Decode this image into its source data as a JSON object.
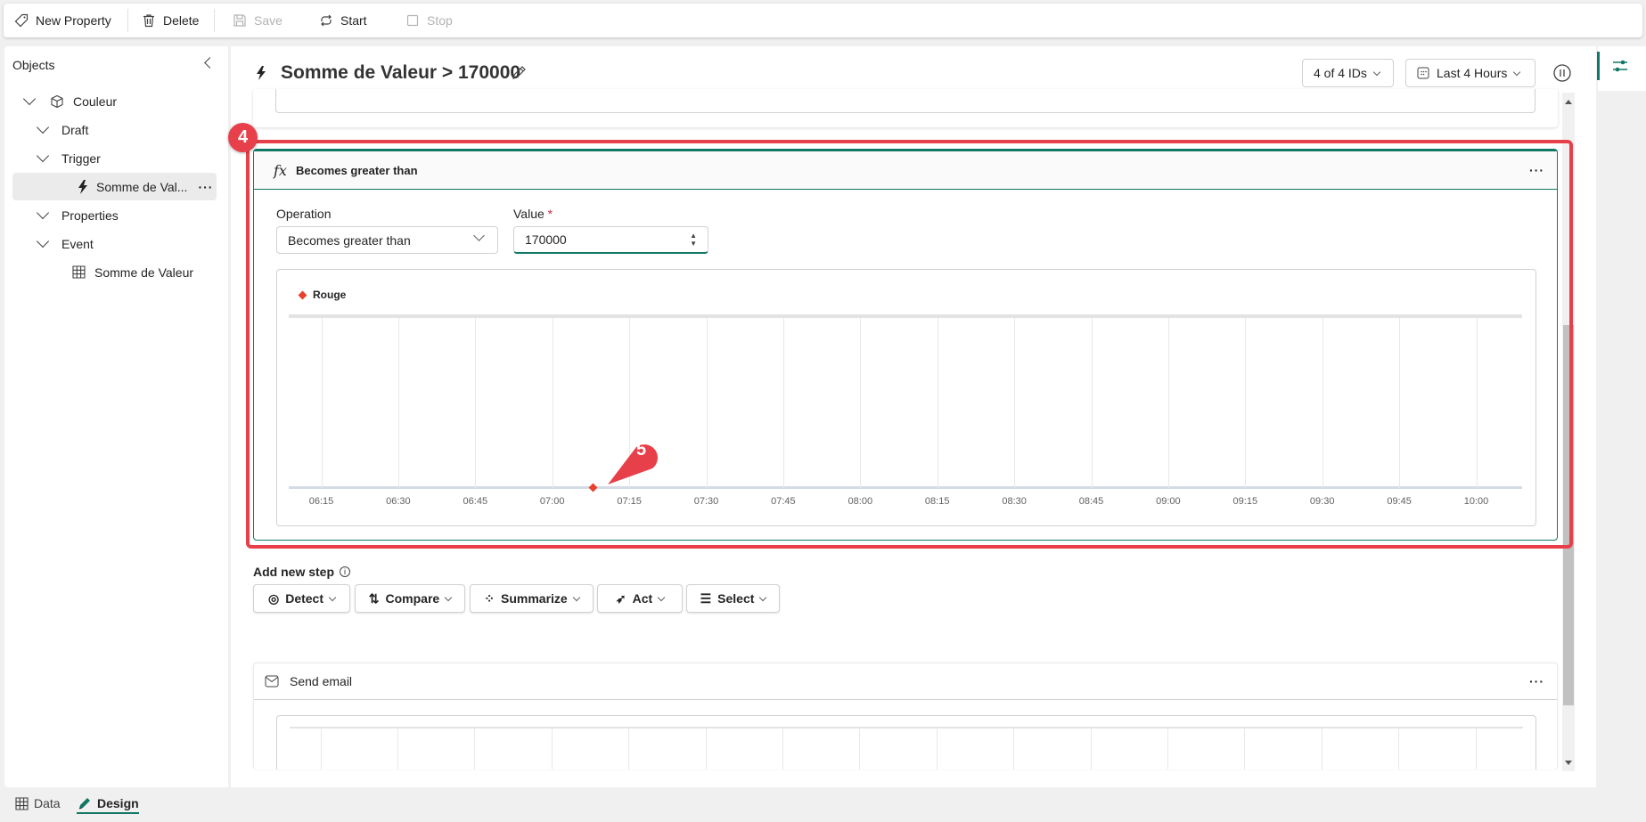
{
  "toolbar": {
    "new_property": "New Property",
    "delete": "Delete",
    "save": "Save",
    "start": "Start",
    "stop": "Stop"
  },
  "sidebar": {
    "title": "Objects",
    "items": [
      {
        "label": "Couleur",
        "icon": "cube-icon"
      },
      {
        "label": "Draft"
      },
      {
        "label": "Trigger"
      },
      {
        "label": "Somme de Val...",
        "icon": "lightning-icon",
        "selected": true
      },
      {
        "label": "Properties"
      },
      {
        "label": "Event"
      },
      {
        "label": "Somme de Valeur",
        "icon": "table-icon"
      }
    ]
  },
  "header": {
    "title": "Somme de Valeur > 170000",
    "ids_filter": "4 of 4 IDs",
    "time_range": "Last 4 Hours"
  },
  "condition_card": {
    "title": "Becomes greater than",
    "operation_label": "Operation",
    "operation_value": "Becomes greater than",
    "value_label": "Value",
    "required_mark": "*",
    "value": "170000",
    "annotation_badge": "4"
  },
  "chart_data": {
    "type": "scatter",
    "legend": "top-left",
    "grid": true,
    "series": [
      {
        "name": "Rouge",
        "color": "#e8412c",
        "points": [
          {
            "x": "07:08"
          }
        ]
      }
    ],
    "x_ticks": [
      "06:15",
      "06:30",
      "06:45",
      "07:00",
      "07:15",
      "07:30",
      "07:45",
      "08:00",
      "08:15",
      "08:30",
      "08:45",
      "09:00",
      "09:15",
      "09:30",
      "09:45",
      "10:00"
    ],
    "annotation_badge": "5"
  },
  "add_step": {
    "label": "Add new step",
    "buttons": [
      "Detect",
      "Compare",
      "Summarize",
      "Act",
      "Select"
    ]
  },
  "email_card": {
    "title": "Send email"
  },
  "bottom_tabs": {
    "data": "Data",
    "design": "Design",
    "active": "Design"
  },
  "colors": {
    "accent": "#117865",
    "annotation": "#e8404a"
  }
}
